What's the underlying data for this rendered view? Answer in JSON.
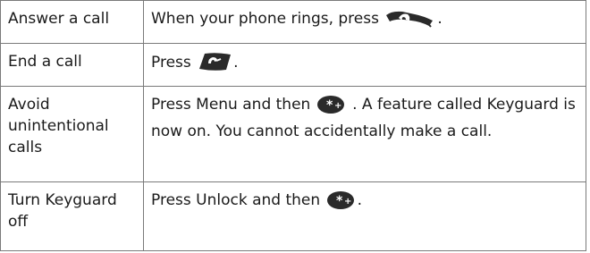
{
  "rows": [
    {
      "action": "Answer a call",
      "desc_before": "When your phone rings, press ",
      "icon": "call-key-icon",
      "desc_after": "."
    },
    {
      "action": "End a call",
      "desc_before": "Press ",
      "icon": "end-key-icon",
      "desc_after": "."
    },
    {
      "action": "Avoid unintentional calls",
      "desc_before": "Press ",
      "keyword": "Menu",
      "desc_mid": " and then ",
      "icon": "star-key-icon",
      "desc_after": " . A feature called Keyguard is now on. You cannot accidentally make a call."
    },
    {
      "action": "Turn Keyguard off",
      "desc_before": "Press ",
      "keyword": "Unlock",
      "desc_mid": " and then ",
      "icon": "star-key-icon",
      "desc_after": "."
    }
  ]
}
